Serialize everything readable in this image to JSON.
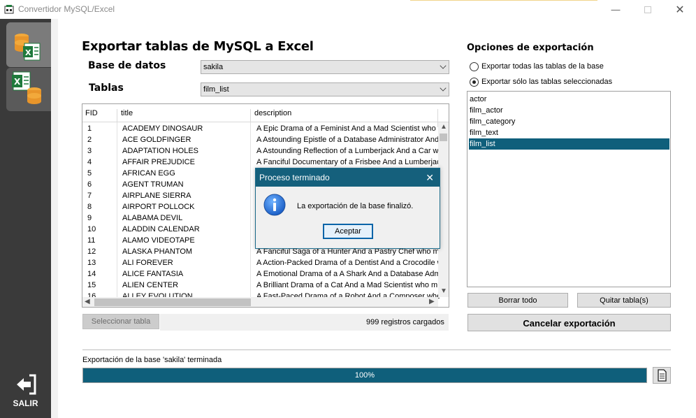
{
  "window": {
    "title": "Convertidor MySQL/Excel"
  },
  "sidebar": {
    "exit_label": "SALIR"
  },
  "main": {
    "title": "Exportar tablas de MySQL a Excel",
    "database_label": "Base de datos",
    "database_value": "sakila",
    "tables_label": "Tablas",
    "tables_value": "film_list",
    "grid": {
      "columns": [
        "FID",
        "title",
        "description"
      ],
      "rows": [
        [
          "1",
          "ACADEMY DINOSAUR",
          "A Epic Drama of a Feminist And a Mad Scientist who mu"
        ],
        [
          "2",
          "ACE GOLDFINGER",
          "A Astounding Epistle of a Database Administrator And"
        ],
        [
          "3",
          "ADAPTATION HOLES",
          "A Astounding Reflection of a Lumberjack And a Car wh"
        ],
        [
          "4",
          "AFFAIR PREJUDICE",
          "A Fanciful Documentary of a Frisbee And a Lumberjack"
        ],
        [
          "5",
          "AFRICAN EGG",
          ""
        ],
        [
          "6",
          "AGENT TRUMAN",
          ""
        ],
        [
          "7",
          "AIRPLANE SIERRA",
          ""
        ],
        [
          "8",
          "AIRPORT POLLOCK",
          ""
        ],
        [
          "9",
          "ALABAMA DEVIL",
          ""
        ],
        [
          "10",
          "ALADDIN CALENDAR",
          ""
        ],
        [
          "11",
          "ALAMO VIDEOTAPE",
          ""
        ],
        [
          "12",
          "ALASKA PHANTOM",
          "A Fanciful Saga of a Hunter And a Pastry Chef who mu"
        ],
        [
          "13",
          "ALI FOREVER",
          "A Action-Packed Drama of a Dentist And a Crocodile w"
        ],
        [
          "14",
          "ALICE FANTASIA",
          "A Emotional Drama of a A Shark And a Database Admir"
        ],
        [
          "15",
          "ALIEN CENTER",
          "A Brilliant Drama of a Cat And a Mad Scientist who mus"
        ],
        [
          "16",
          "ALLEY EVOLUTION",
          "A Fast-Paced Drama of a Robot And a Composer whe"
        ]
      ]
    },
    "select_table_button": "Seleccionar tabla",
    "records_loaded": "999 registros cargados"
  },
  "options": {
    "title": "Opciones de exportación",
    "radio_all": "Exportar todas las tablas de la base",
    "radio_selected": "Exportar sólo las tablas seleccionadas",
    "selected_radio": "selected",
    "tables": [
      "actor",
      "film_actor",
      "film_category",
      "film_text",
      "film_list"
    ],
    "selected_table": "film_list",
    "clear_all_button": "Borrar todo",
    "remove_table_button": "Quitar tabla(s)",
    "cancel_export_button": "Cancelar exportación"
  },
  "status": {
    "text": "Exportación de la base 'sakila' terminada",
    "progress_percent": 100,
    "progress_label": "100%"
  },
  "dialog": {
    "title": "Proceso terminado",
    "message": "La exportación de la base finalizó.",
    "ok_button": "Aceptar"
  },
  "colors": {
    "accent": "#0f5f7b",
    "sidebar": "#3a3a3a",
    "dialog_title": "#15607c"
  }
}
